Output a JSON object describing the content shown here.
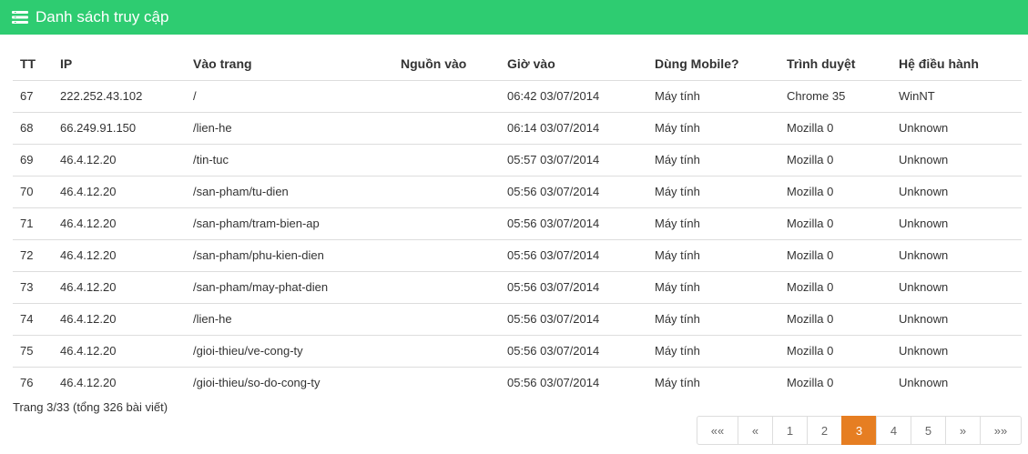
{
  "header": {
    "title": "Danh sách truy cập",
    "icon": "list-icon"
  },
  "table": {
    "columns": [
      "TT",
      "IP",
      "Vào trang",
      "Nguồn vào",
      "Giờ vào",
      "Dùng Mobile?",
      "Trình duyệt",
      "Hệ điều hành"
    ],
    "rows": [
      [
        "67",
        "222.252.43.102",
        "/",
        "",
        "06:42 03/07/2014",
        "Máy tính",
        "Chrome 35",
        "WinNT"
      ],
      [
        "68",
        "66.249.91.150",
        "/lien-he",
        "",
        "06:14 03/07/2014",
        "Máy tính",
        "Mozilla 0",
        "Unknown"
      ],
      [
        "69",
        "46.4.12.20",
        "/tin-tuc",
        "",
        "05:57 03/07/2014",
        "Máy tính",
        "Mozilla 0",
        "Unknown"
      ],
      [
        "70",
        "46.4.12.20",
        "/san-pham/tu-dien",
        "",
        "05:56 03/07/2014",
        "Máy tính",
        "Mozilla 0",
        "Unknown"
      ],
      [
        "71",
        "46.4.12.20",
        "/san-pham/tram-bien-ap",
        "",
        "05:56 03/07/2014",
        "Máy tính",
        "Mozilla 0",
        "Unknown"
      ],
      [
        "72",
        "46.4.12.20",
        "/san-pham/phu-kien-dien",
        "",
        "05:56 03/07/2014",
        "Máy tính",
        "Mozilla 0",
        "Unknown"
      ],
      [
        "73",
        "46.4.12.20",
        "/san-pham/may-phat-dien",
        "",
        "05:56 03/07/2014",
        "Máy tính",
        "Mozilla 0",
        "Unknown"
      ],
      [
        "74",
        "46.4.12.20",
        "/lien-he",
        "",
        "05:56 03/07/2014",
        "Máy tính",
        "Mozilla 0",
        "Unknown"
      ],
      [
        "75",
        "46.4.12.20",
        "/gioi-thieu/ve-cong-ty",
        "",
        "05:56 03/07/2014",
        "Máy tính",
        "Mozilla 0",
        "Unknown"
      ],
      [
        "76",
        "46.4.12.20",
        "/gioi-thieu/so-do-cong-ty",
        "",
        "05:56 03/07/2014",
        "Máy tính",
        "Mozilla 0",
        "Unknown"
      ]
    ]
  },
  "footer": {
    "page_info": "Trang 3/33 (tổng 326 bài viết)"
  },
  "pagination": {
    "first": "««",
    "prev": "«",
    "pages": [
      "1",
      "2",
      "3",
      "4",
      "5"
    ],
    "current": "3",
    "next": "»",
    "last": "»»"
  },
  "colors": {
    "header": "#2ecc71",
    "active_page": "#e67e22"
  }
}
